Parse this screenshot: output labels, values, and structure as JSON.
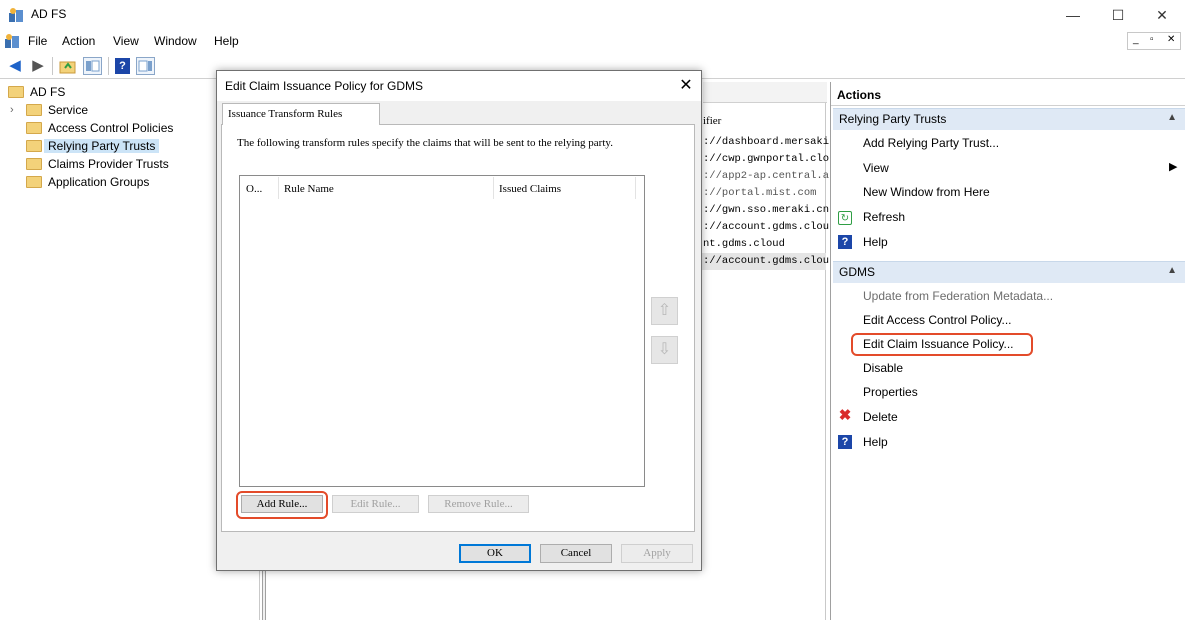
{
  "window": {
    "title": "AD FS",
    "minimize": "—",
    "maximize": "☐",
    "close": "✕"
  },
  "menu": {
    "items": [
      "File",
      "Action",
      "View",
      "Window",
      "Help"
    ],
    "mdi": [
      "_",
      "▫",
      "✕"
    ]
  },
  "tree": {
    "root": "AD FS",
    "items": [
      "Service",
      "Access Control Policies",
      "Relying Party Trusts",
      "Claims Provider Trusts",
      "Application Groups"
    ]
  },
  "middle": {
    "partial_header": "ifier",
    "identifiers": [
      "://dashboard.mersaki",
      "://cwp.gwnportal.clo",
      "://app2-ap.central.a",
      "://portal.mist.com",
      "://gwn.sso.meraki.cn",
      "://account.gdms.clou",
      "nt.gdms.cloud",
      "://account.gdms.clou"
    ]
  },
  "actions": {
    "header": "Actions",
    "section1": {
      "title": "Relying Party Trusts",
      "items": [
        "Add Relying Party Trust...",
        "View",
        "New Window from Here",
        "Refresh",
        "Help"
      ]
    },
    "section2": {
      "title": "GDMS",
      "items": [
        "Update from Federation Metadata...",
        "Edit Access Control Policy...",
        "Edit Claim Issuance Policy...",
        "Disable",
        "Properties",
        "Delete",
        "Help"
      ]
    }
  },
  "dialog": {
    "title": "Edit Claim Issuance Policy for GDMS",
    "tab": "Issuance Transform Rules",
    "description": "The following transform rules specify the claims that will be sent to the relying party.",
    "columns": [
      "O...",
      "Rule Name",
      "Issued Claims"
    ],
    "buttons": {
      "add_rule": "Add Rule...",
      "edit_rule": "Edit Rule...",
      "remove_rule": "Remove Rule...",
      "ok": "OK",
      "cancel": "Cancel",
      "apply": "Apply"
    }
  },
  "colors": {
    "selection": "#cce4f7",
    "section_header": "#dfe9f5",
    "highlight": "#e34b2a",
    "help_icon": "#1c46a8",
    "delete_icon": "#d92b2b",
    "refresh_icon": "#2f9e44"
  },
  "icons": {
    "back": "arrow-left-icon",
    "forward": "arrow-right-icon",
    "help": "help-icon",
    "refresh": "refresh-icon",
    "delete": "delete-icon"
  }
}
